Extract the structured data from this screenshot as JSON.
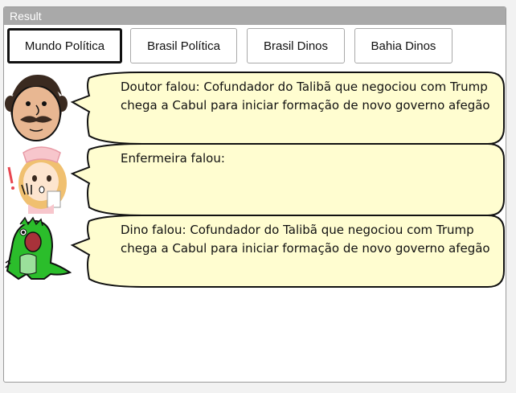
{
  "window": {
    "title": "Result"
  },
  "tabs": [
    {
      "label": "Mundo Política",
      "active": true
    },
    {
      "label": "Brasil Política",
      "active": false
    },
    {
      "label": "Brasil Dinos",
      "active": false
    },
    {
      "label": "Bahia Dinos",
      "active": false
    }
  ],
  "messages": [
    {
      "speaker": "doctor",
      "icon": "doctor-avatar-icon",
      "text": "Doutor falou: Cofundador do Talibã que negociou com Trump chega a Cabul para iniciar formação de novo governo afegão"
    },
    {
      "speaker": "nurse",
      "icon": "nurse-avatar-icon",
      "text": "Enfermeira falou:"
    },
    {
      "speaker": "dino",
      "icon": "dino-avatar-icon",
      "text": "Dino falou: Cofundador do Talibã que negociou com Trump chega a Cabul para iniciar formação de novo governo afegão"
    }
  ],
  "colors": {
    "bubble_fill": "#fffdd0",
    "titlebar": "#a9a9a9",
    "dino_green": "#2bbd2b"
  }
}
